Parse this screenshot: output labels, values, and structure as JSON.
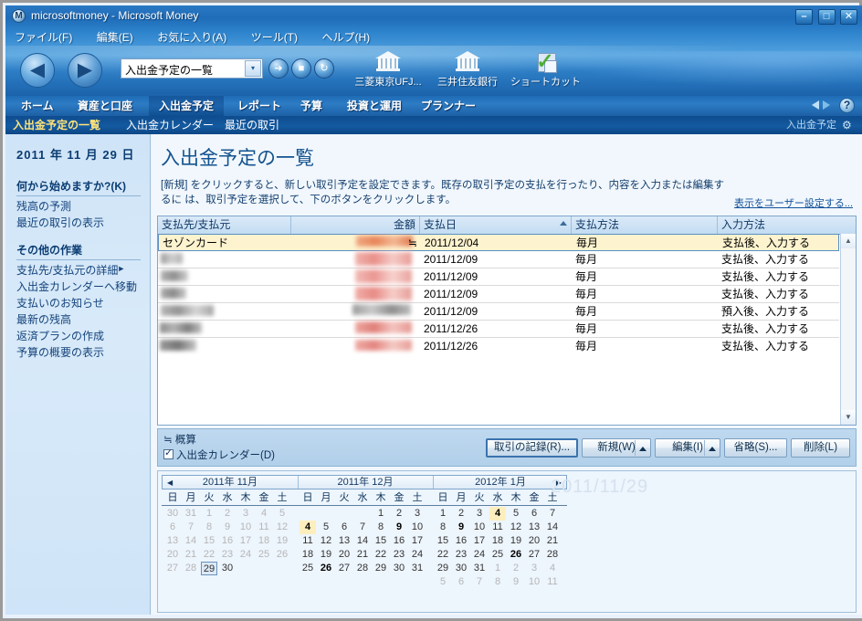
{
  "window": {
    "app_icon": "M",
    "title": "microsoftmoney - Microsoft Money",
    "minimize": "–",
    "maximize": "□",
    "close": "✕"
  },
  "menu": {
    "items": [
      {
        "label": "ファイル(F)"
      },
      {
        "label": "編集(E)"
      },
      {
        "label": "お気に入り(A)"
      },
      {
        "label": "ツール(T)"
      },
      {
        "label": "ヘルプ(H)"
      }
    ]
  },
  "toolbar": {
    "back": "◀",
    "forward": "▶",
    "address_value": "入出金予定の一覧",
    "address_caret": "▾",
    "go": "➜",
    "stop": "■",
    "refresh": "↻",
    "shortcuts": [
      {
        "label": "三菱東京UFJ...",
        "icon": "bank-icon"
      },
      {
        "label": "三井住友銀行",
        "icon": "bank-icon"
      },
      {
        "label": "ショートカット...",
        "icon": "checkmark-page-icon"
      }
    ]
  },
  "nav": {
    "tabs": [
      {
        "label": "ホーム",
        "active": false
      },
      {
        "label": "資産と口座",
        "active": false
      },
      {
        "label": "入出金予定",
        "active": true
      },
      {
        "label": "レポート",
        "active": false
      },
      {
        "label": "予算",
        "active": false
      },
      {
        "label": "投資と運用",
        "active": false
      },
      {
        "label": "プランナー",
        "active": false
      }
    ],
    "help": "?"
  },
  "subnav": {
    "items": [
      {
        "label": "入出金予定の一覧",
        "current": true
      },
      {
        "label": "入出金カレンダー",
        "current": false
      },
      {
        "label": "最近の取引",
        "current": false
      }
    ],
    "right_label": "入出金予定",
    "right_icon": "gear-icon"
  },
  "sidebar": {
    "date": "2011 年 11 月 29 日",
    "section1_title": "何から始めますか?(K)",
    "section1_links": [
      {
        "label": "残高の予測"
      },
      {
        "label": "最近の取引の表示"
      }
    ],
    "section2_title": "その他の作業",
    "section2_links": [
      {
        "label": "支払先/支払元の詳細",
        "submenu": true
      },
      {
        "label": "入出金カレンダーへ移動",
        "submenu": false
      },
      {
        "label": "支払いのお知らせ",
        "submenu": false
      },
      {
        "label": "最新の残高",
        "submenu": false
      },
      {
        "label": "返済プランの作成",
        "submenu": false
      },
      {
        "label": "予算の概要の表示",
        "submenu": false
      }
    ]
  },
  "main": {
    "page_title": "入出金予定の一覧",
    "description_line1": "[新規] をクリックすると、新しい取引予定を設定できます。既存の取引予定の支払を行ったり、内容を入力または編集するに",
    "description_line2": "は、取引予定を選択して、下のボタンをクリックします。",
    "customize_link": "表示をユーザー設定する...",
    "grid": {
      "columns": [
        {
          "label": "支払先/支払元",
          "align": "left",
          "sorted": false
        },
        {
          "label": "金額",
          "align": "right",
          "sorted": false
        },
        {
          "label": "支払日",
          "align": "left",
          "sorted": true,
          "sort_dir": "asc"
        },
        {
          "label": "支払方法",
          "align": "left",
          "sorted": false
        },
        {
          "label": "入力方法",
          "align": "left",
          "sorted": false
        }
      ],
      "rows": [
        {
          "payee": "セゾンカード",
          "payee_redacted": false,
          "amount": "≒",
          "amount_redacted": true,
          "date": "2011/12/04",
          "method": "毎月",
          "entry": "支払後、入力する",
          "selected": true
        },
        {
          "payee": "",
          "payee_redacted": true,
          "amount": "",
          "amount_redacted": true,
          "date": "2011/12/09",
          "method": "毎月",
          "entry": "支払後、入力する",
          "selected": false
        },
        {
          "payee": "",
          "payee_redacted": true,
          "amount": "",
          "amount_redacted": true,
          "date": "2011/12/09",
          "method": "毎月",
          "entry": "支払後、入力する",
          "selected": false
        },
        {
          "payee": "",
          "payee_redacted": true,
          "amount": "",
          "amount_redacted": true,
          "date": "2011/12/09",
          "method": "毎月",
          "entry": "支払後、入力する",
          "selected": false
        },
        {
          "payee": "",
          "payee_redacted": true,
          "amount": "",
          "amount_redacted": true,
          "date": "2011/12/09",
          "method": "毎月",
          "entry": "預入後、入力する",
          "selected": false
        },
        {
          "payee": "",
          "payee_redacted": true,
          "amount": "",
          "amount_redacted": true,
          "date": "2011/12/26",
          "method": "毎月",
          "entry": "支払後、入力する",
          "selected": false
        },
        {
          "payee": "",
          "payee_redacted": true,
          "amount": "",
          "amount_redacted": true,
          "date": "2011/12/26",
          "method": "毎月",
          "entry": "支払後、入力する",
          "selected": false
        }
      ],
      "scroll_up": "▲",
      "scroll_down": "▼"
    },
    "actionbar": {
      "approx_label": "≒ 概算",
      "checkbox_label": "入出金カレンダー(D)",
      "checkbox_checked": true,
      "buttons": [
        {
          "label": "取引の記録(R)...",
          "primary": true,
          "split": false
        },
        {
          "label": "新規(W)",
          "primary": false,
          "split": true
        },
        {
          "label": "編集(I)",
          "primary": false,
          "split": true
        },
        {
          "label": "省略(S)...",
          "primary": false,
          "split": false
        },
        {
          "label": "削除(L)",
          "primary": false,
          "split": false
        }
      ]
    },
    "calendars": {
      "prev_arrow": "◀",
      "next_arrow": "▶",
      "dow": [
        "日",
        "月",
        "火",
        "水",
        "木",
        "金",
        "土"
      ],
      "watermark": "2011/11/29",
      "months": [
        {
          "title": "2011年 11月",
          "weeks": [
            [
              {
                "d": "30",
                "s": "out"
              },
              {
                "d": "31",
                "s": "out"
              },
              {
                "d": "1",
                "s": "out"
              },
              {
                "d": "2",
                "s": "out"
              },
              {
                "d": "3",
                "s": "out"
              },
              {
                "d": "4",
                "s": "out"
              },
              {
                "d": "5",
                "s": "out"
              }
            ],
            [
              {
                "d": "6",
                "s": "out"
              },
              {
                "d": "7",
                "s": "out"
              },
              {
                "d": "8",
                "s": "out"
              },
              {
                "d": "9",
                "s": "out"
              },
              {
                "d": "10",
                "s": "out"
              },
              {
                "d": "11",
                "s": "out"
              },
              {
                "d": "12",
                "s": "out"
              }
            ],
            [
              {
                "d": "13",
                "s": "out"
              },
              {
                "d": "14",
                "s": "out"
              },
              {
                "d": "15",
                "s": "out"
              },
              {
                "d": "16",
                "s": "out"
              },
              {
                "d": "17",
                "s": "out"
              },
              {
                "d": "18",
                "s": "out"
              },
              {
                "d": "19",
                "s": "out"
              }
            ],
            [
              {
                "d": "20",
                "s": "out"
              },
              {
                "d": "21",
                "s": "out"
              },
              {
                "d": "22",
                "s": "out"
              },
              {
                "d": "23",
                "s": "out"
              },
              {
                "d": "24",
                "s": "out"
              },
              {
                "d": "25",
                "s": "out"
              },
              {
                "d": "26",
                "s": "out"
              }
            ],
            [
              {
                "d": "27",
                "s": "out"
              },
              {
                "d": "28",
                "s": "out"
              },
              {
                "d": "29",
                "s": "today"
              },
              {
                "d": "30",
                "s": "norm"
              },
              {
                "d": "",
                "s": ""
              },
              {
                "d": "",
                "s": ""
              },
              {
                "d": "",
                "s": ""
              }
            ],
            [
              {
                "d": "",
                "s": ""
              },
              {
                "d": "",
                "s": ""
              },
              {
                "d": "",
                "s": ""
              },
              {
                "d": "",
                "s": ""
              },
              {
                "d": "",
                "s": ""
              },
              {
                "d": "",
                "s": ""
              },
              {
                "d": "",
                "s": ""
              }
            ]
          ]
        },
        {
          "title": "2011年 12月",
          "weeks": [
            [
              {
                "d": "",
                "s": ""
              },
              {
                "d": "",
                "s": ""
              },
              {
                "d": "",
                "s": ""
              },
              {
                "d": "",
                "s": ""
              },
              {
                "d": "1",
                "s": "norm"
              },
              {
                "d": "2",
                "s": "norm"
              },
              {
                "d": "3",
                "s": "norm"
              }
            ],
            [
              {
                "d": "4",
                "s": "hl"
              },
              {
                "d": "5",
                "s": "norm"
              },
              {
                "d": "6",
                "s": "norm"
              },
              {
                "d": "7",
                "s": "norm"
              },
              {
                "d": "8",
                "s": "norm"
              },
              {
                "d": "9",
                "s": "bold"
              },
              {
                "d": "10",
                "s": "norm"
              }
            ],
            [
              {
                "d": "11",
                "s": "norm"
              },
              {
                "d": "12",
                "s": "norm"
              },
              {
                "d": "13",
                "s": "norm"
              },
              {
                "d": "14",
                "s": "norm"
              },
              {
                "d": "15",
                "s": "norm"
              },
              {
                "d": "16",
                "s": "norm"
              },
              {
                "d": "17",
                "s": "norm"
              }
            ],
            [
              {
                "d": "18",
                "s": "norm"
              },
              {
                "d": "19",
                "s": "norm"
              },
              {
                "d": "20",
                "s": "norm"
              },
              {
                "d": "21",
                "s": "norm"
              },
              {
                "d": "22",
                "s": "norm"
              },
              {
                "d": "23",
                "s": "norm"
              },
              {
                "d": "24",
                "s": "norm"
              }
            ],
            [
              {
                "d": "25",
                "s": "norm"
              },
              {
                "d": "26",
                "s": "bold"
              },
              {
                "d": "27",
                "s": "norm"
              },
              {
                "d": "28",
                "s": "norm"
              },
              {
                "d": "29",
                "s": "norm"
              },
              {
                "d": "30",
                "s": "norm"
              },
              {
                "d": "31",
                "s": "norm"
              }
            ],
            [
              {
                "d": "",
                "s": ""
              },
              {
                "d": "",
                "s": ""
              },
              {
                "d": "",
                "s": ""
              },
              {
                "d": "",
                "s": ""
              },
              {
                "d": "",
                "s": ""
              },
              {
                "d": "",
                "s": ""
              },
              {
                "d": "",
                "s": ""
              }
            ]
          ]
        },
        {
          "title": "2012年 1月",
          "weeks": [
            [
              {
                "d": "1",
                "s": "norm"
              },
              {
                "d": "2",
                "s": "norm"
              },
              {
                "d": "3",
                "s": "norm"
              },
              {
                "d": "4",
                "s": "hl"
              },
              {
                "d": "5",
                "s": "norm"
              },
              {
                "d": "6",
                "s": "norm"
              },
              {
                "d": "7",
                "s": "norm"
              }
            ],
            [
              {
                "d": "8",
                "s": "norm"
              },
              {
                "d": "9",
                "s": "bold"
              },
              {
                "d": "10",
                "s": "norm"
              },
              {
                "d": "11",
                "s": "norm"
              },
              {
                "d": "12",
                "s": "norm"
              },
              {
                "d": "13",
                "s": "norm"
              },
              {
                "d": "14",
                "s": "norm"
              }
            ],
            [
              {
                "d": "15",
                "s": "norm"
              },
              {
                "d": "16",
                "s": "norm"
              },
              {
                "d": "17",
                "s": "norm"
              },
              {
                "d": "18",
                "s": "norm"
              },
              {
                "d": "19",
                "s": "norm"
              },
              {
                "d": "20",
                "s": "norm"
              },
              {
                "d": "21",
                "s": "norm"
              }
            ],
            [
              {
                "d": "22",
                "s": "norm"
              },
              {
                "d": "23",
                "s": "norm"
              },
              {
                "d": "24",
                "s": "norm"
              },
              {
                "d": "25",
                "s": "norm"
              },
              {
                "d": "26",
                "s": "bold"
              },
              {
                "d": "27",
                "s": "norm"
              },
              {
                "d": "28",
                "s": "norm"
              }
            ],
            [
              {
                "d": "29",
                "s": "norm"
              },
              {
                "d": "30",
                "s": "norm"
              },
              {
                "d": "31",
                "s": "norm"
              },
              {
                "d": "1",
                "s": "out"
              },
              {
                "d": "2",
                "s": "out"
              },
              {
                "d": "3",
                "s": "out"
              },
              {
                "d": "4",
                "s": "out"
              }
            ],
            [
              {
                "d": "5",
                "s": "out"
              },
              {
                "d": "6",
                "s": "out"
              },
              {
                "d": "7",
                "s": "out"
              },
              {
                "d": "8",
                "s": "out"
              },
              {
                "d": "9",
                "s": "out"
              },
              {
                "d": "10",
                "s": "out"
              },
              {
                "d": "11",
                "s": "out"
              }
            ]
          ]
        }
      ]
    }
  },
  "colors": {
    "titlebar_blue": "#1f6cb8",
    "navbar_blue": "#1c5fa5",
    "subnav_blue": "#0e4c8e",
    "sidebar_bg": "#cfe4f8",
    "content_bg": "#f1f7fd",
    "selected_row": "#fdf3cf",
    "accent_text": "#14538f",
    "current_subnav": "#ffe27a"
  }
}
